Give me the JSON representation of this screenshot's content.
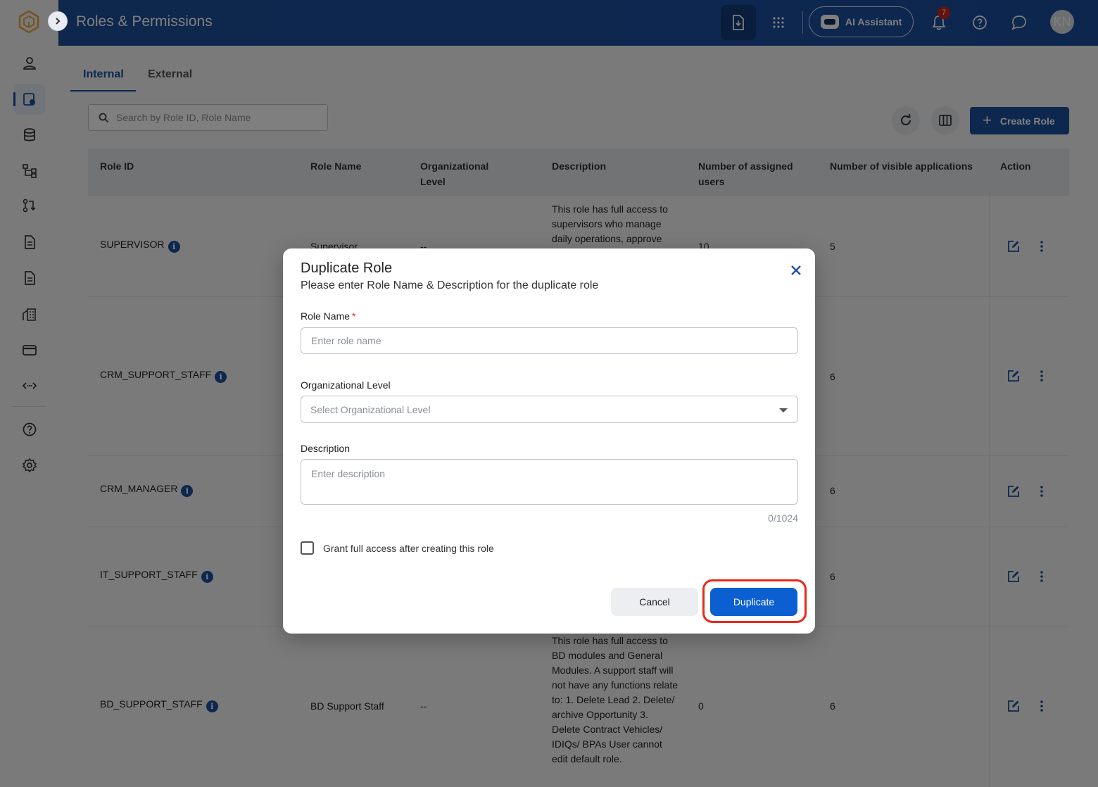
{
  "app": {
    "title": "Roles & Permissions"
  },
  "header": {
    "ai_label": "AI Assistant",
    "notification_count": "7",
    "avatar_initials": "KN"
  },
  "rail": {
    "items": [
      "user-icon",
      "roles-icon",
      "database-icon",
      "hierarchy-icon",
      "workflow-icon",
      "document-icon",
      "report-icon",
      "building-icon",
      "card-icon",
      "api-icon",
      "help-icon",
      "settings-icon"
    ],
    "active": "roles-icon"
  },
  "tabs": [
    {
      "label": "Internal",
      "active": true
    },
    {
      "label": "External",
      "active": false
    }
  ],
  "search": {
    "placeholder": "Search by Role ID, Role Name"
  },
  "toolbar": {
    "create_label": "Create Role"
  },
  "table": {
    "columns": [
      "Role ID",
      "Role Name",
      "Organizational Level",
      "Description",
      "Number of assigned users",
      "Number of visible applications",
      "Action"
    ],
    "rows": [
      {
        "role_id": "SUPERVISOR",
        "role_name": "Supervisor",
        "org_level": "--",
        "description": "This role has full access to supervisors who manage daily operations, approve",
        "users": "10",
        "apps": "5"
      },
      {
        "role_id": "CRM_SUPPORT_STAFF",
        "role_name": "",
        "org_level": "",
        "description": "",
        "users": "",
        "apps": "6"
      },
      {
        "role_id": "CRM_MANAGER",
        "role_name": "",
        "org_level": "",
        "description": "",
        "users": "",
        "apps": "6"
      },
      {
        "role_id": "IT_SUPPORT_STAFF",
        "role_name": "",
        "org_level": "",
        "description": "",
        "users": "",
        "apps": "6"
      },
      {
        "role_id": "BD_SUPPORT_STAFF",
        "role_name": "BD Support Staff",
        "org_level": "--",
        "description": "This role has full access to BD modules and General Modules. A support staff will not have any functions relate to: 1. Delete Lead 2. Delete/ archive Opportunity 3. Delete Contract Vehicles/ IDIQs/ BPAs User cannot edit default role.",
        "users": "0",
        "apps": "6"
      }
    ]
  },
  "modal": {
    "title": "Duplicate Role",
    "subtitle": "Please enter Role Name & Description for the duplicate role",
    "role_name_label": "Role Name",
    "role_name_required": "*",
    "role_name_placeholder": "Enter role name",
    "org_level_label": "Organizational Level",
    "org_level_placeholder": "Select Organizational Level",
    "description_label": "Description",
    "description_placeholder": "Enter description",
    "counter": "0/1024",
    "checkbox_label": "Grant full access after creating this role",
    "cancel_label": "Cancel",
    "duplicate_label": "Duplicate"
  },
  "colors": {
    "brand": "#1c4f9c",
    "primary_button": "#0b5fd1",
    "highlight": "#e8291c",
    "badge": "#c8261e"
  }
}
